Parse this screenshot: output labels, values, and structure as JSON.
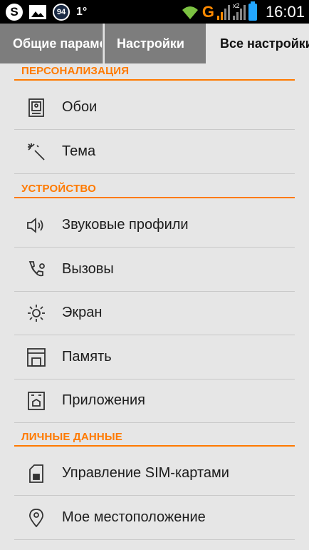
{
  "status_bar": {
    "badge_count": "94",
    "temperature": "1°",
    "network_letter": "G",
    "signal_label": "x2",
    "time": "16:01",
    "skype_letter": "S",
    "colors": {
      "accent_orange": "#ff8a00",
      "wifi_green": "#7cc242",
      "battery_blue": "#23a7ff"
    }
  },
  "tabs": [
    {
      "label": "Общие параметры",
      "active": false
    },
    {
      "label": "Настройки",
      "active": false
    },
    {
      "label": "Все настройки",
      "active": true
    }
  ],
  "sections": [
    {
      "title": "ПЕРСОНАЛИЗАЦИЯ",
      "items": [
        {
          "label": "Обои",
          "icon": "wallpaper-icon"
        },
        {
          "label": "Тема",
          "icon": "magic-wand-icon"
        }
      ]
    },
    {
      "title": "УСТРОЙСТВО",
      "items": [
        {
          "label": "Звуковые профили",
          "icon": "speaker-icon"
        },
        {
          "label": "Вызовы",
          "icon": "phone-settings-icon"
        },
        {
          "label": "Экран",
          "icon": "brightness-icon"
        },
        {
          "label": "Память",
          "icon": "storage-icon"
        },
        {
          "label": "Приложения",
          "icon": "apps-icon"
        }
      ]
    },
    {
      "title": "ЛИЧНЫЕ ДАННЫЕ",
      "items": [
        {
          "label": "Управление SIM-картами",
          "icon": "sim-card-icon"
        },
        {
          "label": "Мое местоположение",
          "icon": "location-pin-icon"
        }
      ]
    }
  ],
  "theme": {
    "accent": "#ff7a00",
    "background": "#e6e6e6",
    "tab_inactive": "#7d7d7d"
  }
}
